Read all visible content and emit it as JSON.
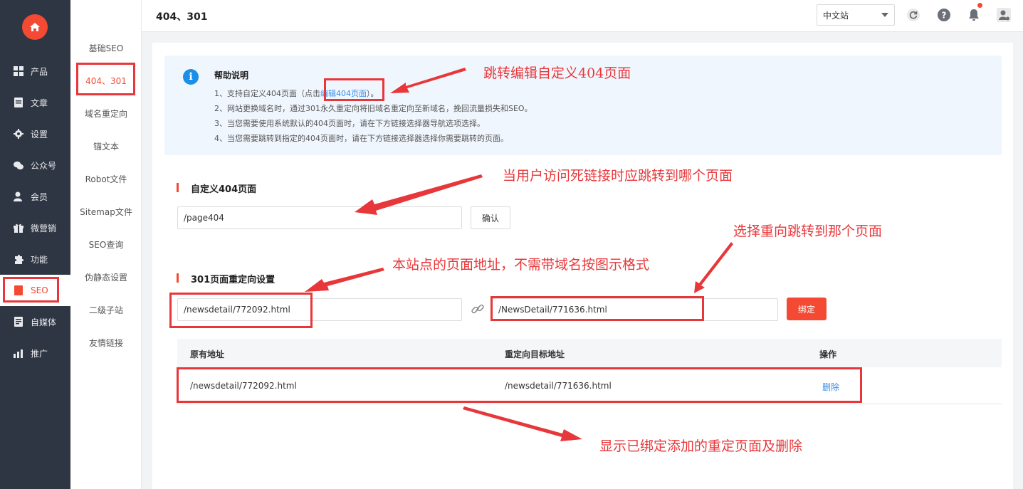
{
  "header": {
    "title": "404、301",
    "site_select": "中文站"
  },
  "sidebar": {
    "items": [
      {
        "label": "产品",
        "icon": "grid-icon"
      },
      {
        "label": "文章",
        "icon": "document-icon"
      },
      {
        "label": "设置",
        "icon": "gear-icon"
      },
      {
        "label": "公众号",
        "icon": "wechat-icon"
      },
      {
        "label": "会员",
        "icon": "member-icon"
      },
      {
        "label": "微营销",
        "icon": "gift-icon"
      },
      {
        "label": "功能",
        "icon": "puzzle-icon"
      },
      {
        "label": "SEO",
        "icon": "seo-icon"
      },
      {
        "label": "自媒体",
        "icon": "media-icon"
      },
      {
        "label": "推广",
        "icon": "chart-icon"
      }
    ]
  },
  "submenu": {
    "items": [
      "基础SEO",
      "404、301",
      "域名重定向",
      "锚文本",
      "Robot文件",
      "Sitemap文件",
      "SEO查询",
      "伪静态设置",
      "二级子站",
      "友情链接"
    ]
  },
  "help": {
    "title": "帮助说明",
    "line1_pre": "1、支持自定义404页面（点击",
    "line1_link": "编辑404页面",
    "line1_post": "）。",
    "line2": "2、网站更换域名时，通过301永久重定向将旧域名重定向至新域名，挽回流量损失和SEO。",
    "line3": "3、当您需要使用系统默认的404页面时，请在下方链接选择器导航选项选择。",
    "line4": "4、当您需要跳转到指定的404页面时，请在下方链接选择器选择你需要跳转的页面。"
  },
  "custom404": {
    "title": "自定义404页面",
    "value": "/page404",
    "confirm_label": "确认"
  },
  "redirect301": {
    "title": "301页面重定向设置",
    "source_value": "/newsdetail/772092.html",
    "target_value": "/NewsDetail/771636.html",
    "bind_label": "绑定"
  },
  "table": {
    "headers": [
      "原有地址",
      "重定向目标地址",
      "操作"
    ],
    "rows": [
      {
        "source": "/newsdetail/772092.html",
        "target": "/newsdetail/771636.html",
        "action": "删除"
      }
    ]
  },
  "annotations": {
    "a1": "跳转编辑自定义404页面",
    "a2": "当用户访问死链接时应跳转到哪个页面",
    "a3": "选择重向跳转到那个页面",
    "a4": "本站点的页面地址，不需带域名按图示格式",
    "a5": "显示已绑定添加的重定页面及删除"
  },
  "colors": {
    "accent": "#f44a33",
    "sidebar_bg": "#2f3643",
    "link": "#3a8ee6",
    "annotation": "#e8373a"
  }
}
